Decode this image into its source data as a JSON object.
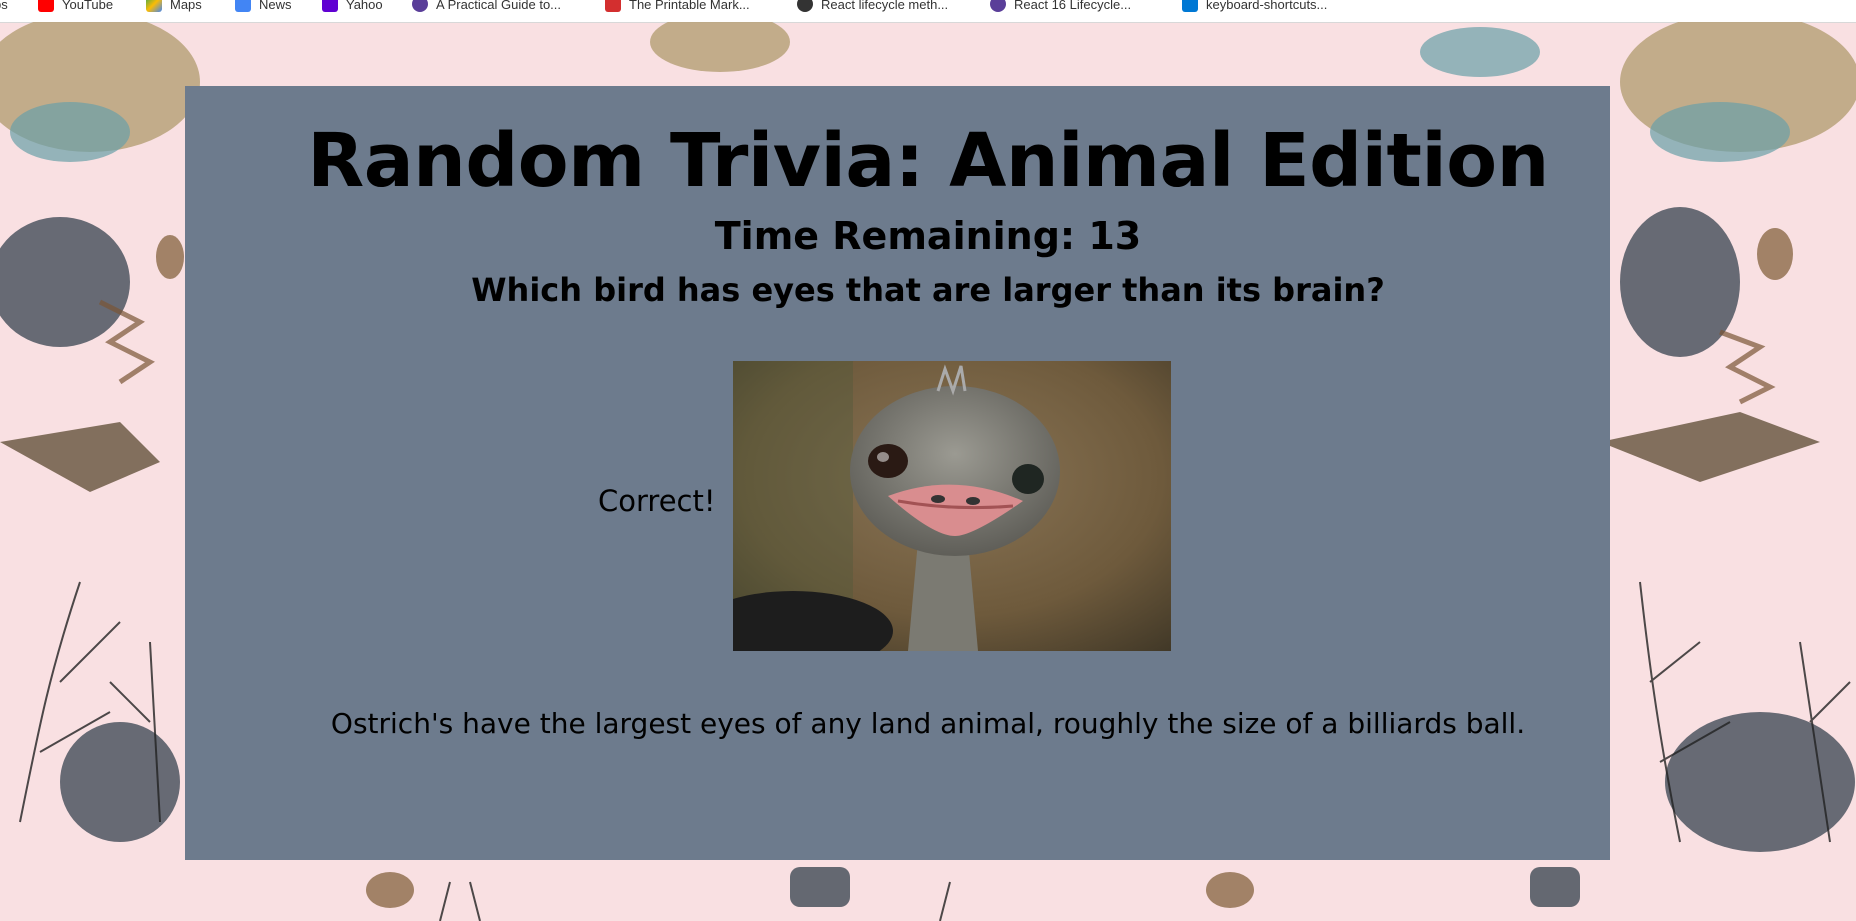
{
  "bookmarks": [
    {
      "label": "ps",
      "icon": "apps-icon",
      "color": "#4285f4"
    },
    {
      "label": "YouTube",
      "icon": "youtube-icon",
      "color": "#ff0000"
    },
    {
      "label": "Maps",
      "icon": "maps-icon",
      "color": "#34a853"
    },
    {
      "label": "News",
      "icon": "news-icon",
      "color": "#4285f4"
    },
    {
      "label": "Yahoo",
      "icon": "yahoo-icon",
      "color": "#6001d2"
    },
    {
      "label": "A Practical Guide to...",
      "icon": "dev-icon",
      "color": "#5a3e99"
    },
    {
      "label": "The Printable Mark...",
      "icon": "printable-icon",
      "color": "#d32f2f"
    },
    {
      "label": "React lifecycle meth...",
      "icon": "react-icon",
      "color": "#333333"
    },
    {
      "label": "React 16 Lifecycle...",
      "icon": "dev-icon",
      "color": "#5a3e99"
    },
    {
      "label": "keyboard-shortcuts...",
      "icon": "vscode-icon",
      "color": "#0078d4"
    }
  ],
  "game": {
    "title": "Random Trivia: Animal Edition",
    "timer_label": "Time Remaining: 13",
    "question": "Which bird has eyes that are larger than its brain?",
    "result": "Correct!",
    "image_subject": "ostrich-photo",
    "fact": "Ostrich's have the largest eyes of any land animal, roughly the size of a billiards ball."
  },
  "colors": {
    "page_background": "#f9e0e2",
    "card_background": "#6d7b8d",
    "text": "#23282e"
  }
}
